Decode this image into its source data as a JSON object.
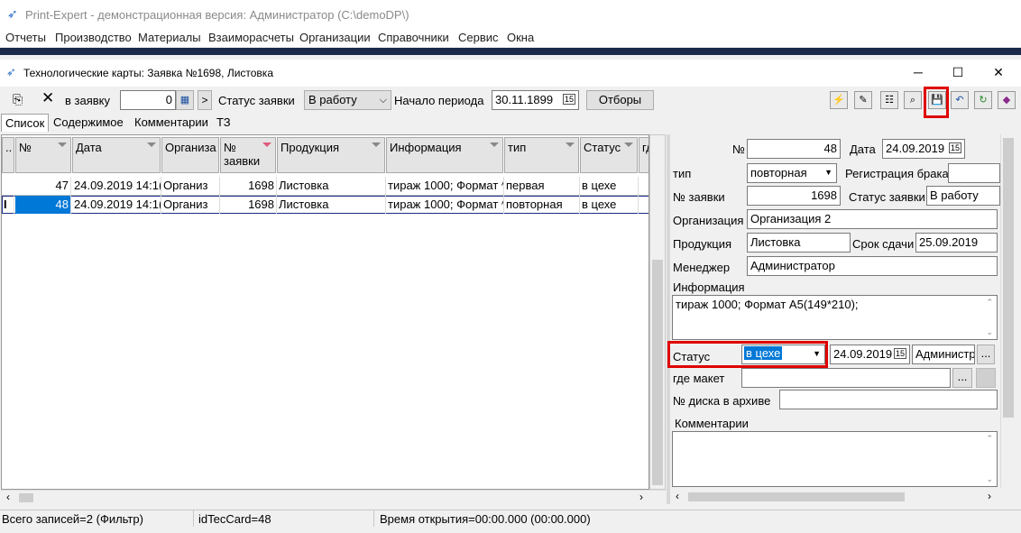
{
  "app": {
    "title": "Print-Expert - демонстрационная версия: Администратор (C:\\demoDP\\)"
  },
  "menu": [
    "Отчеты",
    "Производство",
    "Материалы",
    "Взаиморасчеты",
    "Организации",
    "Справочники",
    "Сервис",
    "Окна"
  ],
  "window": {
    "title": "Технологические карты: Заявка №1698, Листовка",
    "min": "─",
    "max": "☐",
    "close": "✕"
  },
  "toolbar": {
    "to_order_label": "в заявку",
    "order_value": "0",
    "calc_icon": "▦",
    "arrow": ">",
    "order_status_label": "Статус заявки",
    "order_status_value": "В работу",
    "period_label": "Начало периода",
    "period_value": "30.11.1899",
    "calendar_icon": "15",
    "filters_label": "Отборы",
    "icons": [
      "⚡",
      "✎",
      "☷",
      "⌕",
      "💾",
      "↶",
      "↻",
      "◆"
    ]
  },
  "tabs": [
    "Список",
    "Содержимое",
    "Комментарии",
    "ТЗ"
  ],
  "grid": {
    "headers": [
      "№",
      "Дата",
      "Организа",
      "№ заявки",
      "Продукция",
      "Информация",
      "тип",
      "Статус",
      "гд"
    ],
    "rows": [
      {
        "marker": "",
        "num": "47",
        "date": "24.09.2019 14:1(",
        "org": "Организ",
        "order": "1698",
        "product": "Листовка",
        "info": "тираж 1000; Формат ^",
        "type": "первая",
        "status": "в цехе"
      },
      {
        "marker": "I",
        "num": "48",
        "date": "24.09.2019 14:1(",
        "org": "Организ",
        "order": "1698",
        "product": "Листовка",
        "info": "тираж 1000; Формат ^",
        "type": "повторная",
        "status": "в цехе"
      }
    ]
  },
  "form": {
    "num_label": "№",
    "num_value": "48",
    "date_label": "Дата",
    "date_value": "24.09.2019",
    "type_label": "тип",
    "type_value": "повторная",
    "defect_label": "Регистрация брака",
    "order_label": "№ заявки",
    "order_value": "1698",
    "order_status_label": "Статус заявки",
    "order_status_value": "В работу",
    "org_label": "Организация",
    "org_value": "Организация 2",
    "product_label": "Продукция",
    "product_value": "Листовка",
    "deadline_label": "Срок сдачи",
    "deadline_value": "25.09.2019",
    "manager_label": "Менеджер",
    "manager_value": "Администратор",
    "info_label": "Информация",
    "info_value": "тираж 1000; Формат А5(149*210);",
    "status_label": "Статус",
    "status_value": "в цехе",
    "status_date": "24.09.2019",
    "status_user": "Администр",
    "layout_label": "где макет",
    "disk_label": "№ диска в архиве",
    "comments_label": "Комментарии",
    "dots": "..."
  },
  "statusbar": {
    "records": "Всего записей=2 (Фильтр)",
    "id": "idTecCard=48",
    "open_time": "Время открытия=00:00.000 (00:00.000)"
  },
  "colors": {
    "selection": "#0078d7",
    "highlight": "#e00000",
    "dark_bar": "#1b2a4a"
  }
}
